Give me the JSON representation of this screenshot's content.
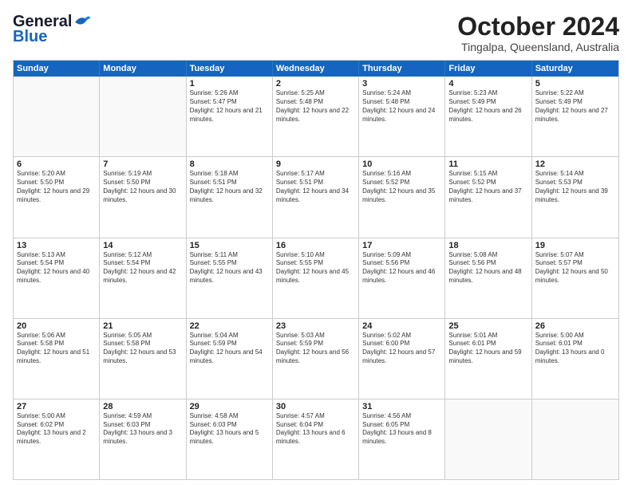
{
  "logo": {
    "line1": "General",
    "line2": "Blue"
  },
  "title": "October 2024",
  "location": "Tingalpa, Queensland, Australia",
  "days_of_week": [
    "Sunday",
    "Monday",
    "Tuesday",
    "Wednesday",
    "Thursday",
    "Friday",
    "Saturday"
  ],
  "weeks": [
    [
      {
        "day": "",
        "sunrise": "",
        "sunset": "",
        "daylight": "",
        "empty": true
      },
      {
        "day": "",
        "sunrise": "",
        "sunset": "",
        "daylight": "",
        "empty": true
      },
      {
        "day": "1",
        "sunrise": "Sunrise: 5:26 AM",
        "sunset": "Sunset: 5:47 PM",
        "daylight": "Daylight: 12 hours and 21 minutes."
      },
      {
        "day": "2",
        "sunrise": "Sunrise: 5:25 AM",
        "sunset": "Sunset: 5:48 PM",
        "daylight": "Daylight: 12 hours and 22 minutes."
      },
      {
        "day": "3",
        "sunrise": "Sunrise: 5:24 AM",
        "sunset": "Sunset: 5:48 PM",
        "daylight": "Daylight: 12 hours and 24 minutes."
      },
      {
        "day": "4",
        "sunrise": "Sunrise: 5:23 AM",
        "sunset": "Sunset: 5:49 PM",
        "daylight": "Daylight: 12 hours and 26 minutes."
      },
      {
        "day": "5",
        "sunrise": "Sunrise: 5:22 AM",
        "sunset": "Sunset: 5:49 PM",
        "daylight": "Daylight: 12 hours and 27 minutes."
      }
    ],
    [
      {
        "day": "6",
        "sunrise": "Sunrise: 5:20 AM",
        "sunset": "Sunset: 5:50 PM",
        "daylight": "Daylight: 12 hours and 29 minutes."
      },
      {
        "day": "7",
        "sunrise": "Sunrise: 5:19 AM",
        "sunset": "Sunset: 5:50 PM",
        "daylight": "Daylight: 12 hours and 30 minutes."
      },
      {
        "day": "8",
        "sunrise": "Sunrise: 5:18 AM",
        "sunset": "Sunset: 5:51 PM",
        "daylight": "Daylight: 12 hours and 32 minutes."
      },
      {
        "day": "9",
        "sunrise": "Sunrise: 5:17 AM",
        "sunset": "Sunset: 5:51 PM",
        "daylight": "Daylight: 12 hours and 34 minutes."
      },
      {
        "day": "10",
        "sunrise": "Sunrise: 5:16 AM",
        "sunset": "Sunset: 5:52 PM",
        "daylight": "Daylight: 12 hours and 35 minutes."
      },
      {
        "day": "11",
        "sunrise": "Sunrise: 5:15 AM",
        "sunset": "Sunset: 5:52 PM",
        "daylight": "Daylight: 12 hours and 37 minutes."
      },
      {
        "day": "12",
        "sunrise": "Sunrise: 5:14 AM",
        "sunset": "Sunset: 5:53 PM",
        "daylight": "Daylight: 12 hours and 39 minutes."
      }
    ],
    [
      {
        "day": "13",
        "sunrise": "Sunrise: 5:13 AM",
        "sunset": "Sunset: 5:54 PM",
        "daylight": "Daylight: 12 hours and 40 minutes."
      },
      {
        "day": "14",
        "sunrise": "Sunrise: 5:12 AM",
        "sunset": "Sunset: 5:54 PM",
        "daylight": "Daylight: 12 hours and 42 minutes."
      },
      {
        "day": "15",
        "sunrise": "Sunrise: 5:11 AM",
        "sunset": "Sunset: 5:55 PM",
        "daylight": "Daylight: 12 hours and 43 minutes."
      },
      {
        "day": "16",
        "sunrise": "Sunrise: 5:10 AM",
        "sunset": "Sunset: 5:55 PM",
        "daylight": "Daylight: 12 hours and 45 minutes."
      },
      {
        "day": "17",
        "sunrise": "Sunrise: 5:09 AM",
        "sunset": "Sunset: 5:56 PM",
        "daylight": "Daylight: 12 hours and 46 minutes."
      },
      {
        "day": "18",
        "sunrise": "Sunrise: 5:08 AM",
        "sunset": "Sunset: 5:56 PM",
        "daylight": "Daylight: 12 hours and 48 minutes."
      },
      {
        "day": "19",
        "sunrise": "Sunrise: 5:07 AM",
        "sunset": "Sunset: 5:57 PM",
        "daylight": "Daylight: 12 hours and 50 minutes."
      }
    ],
    [
      {
        "day": "20",
        "sunrise": "Sunrise: 5:06 AM",
        "sunset": "Sunset: 5:58 PM",
        "daylight": "Daylight: 12 hours and 51 minutes."
      },
      {
        "day": "21",
        "sunrise": "Sunrise: 5:05 AM",
        "sunset": "Sunset: 5:58 PM",
        "daylight": "Daylight: 12 hours and 53 minutes."
      },
      {
        "day": "22",
        "sunrise": "Sunrise: 5:04 AM",
        "sunset": "Sunset: 5:59 PM",
        "daylight": "Daylight: 12 hours and 54 minutes."
      },
      {
        "day": "23",
        "sunrise": "Sunrise: 5:03 AM",
        "sunset": "Sunset: 5:59 PM",
        "daylight": "Daylight: 12 hours and 56 minutes."
      },
      {
        "day": "24",
        "sunrise": "Sunrise: 5:02 AM",
        "sunset": "Sunset: 6:00 PM",
        "daylight": "Daylight: 12 hours and 57 minutes."
      },
      {
        "day": "25",
        "sunrise": "Sunrise: 5:01 AM",
        "sunset": "Sunset: 6:01 PM",
        "daylight": "Daylight: 12 hours and 59 minutes."
      },
      {
        "day": "26",
        "sunrise": "Sunrise: 5:00 AM",
        "sunset": "Sunset: 6:01 PM",
        "daylight": "Daylight: 13 hours and 0 minutes."
      }
    ],
    [
      {
        "day": "27",
        "sunrise": "Sunrise: 5:00 AM",
        "sunset": "Sunset: 6:02 PM",
        "daylight": "Daylight: 13 hours and 2 minutes."
      },
      {
        "day": "28",
        "sunrise": "Sunrise: 4:59 AM",
        "sunset": "Sunset: 6:03 PM",
        "daylight": "Daylight: 13 hours and 3 minutes."
      },
      {
        "day": "29",
        "sunrise": "Sunrise: 4:58 AM",
        "sunset": "Sunset: 6:03 PM",
        "daylight": "Daylight: 13 hours and 5 minutes."
      },
      {
        "day": "30",
        "sunrise": "Sunrise: 4:57 AM",
        "sunset": "Sunset: 6:04 PM",
        "daylight": "Daylight: 13 hours and 6 minutes."
      },
      {
        "day": "31",
        "sunrise": "Sunrise: 4:56 AM",
        "sunset": "Sunset: 6:05 PM",
        "daylight": "Daylight: 13 hours and 8 minutes."
      },
      {
        "day": "",
        "sunrise": "",
        "sunset": "",
        "daylight": "",
        "empty": true
      },
      {
        "day": "",
        "sunrise": "",
        "sunset": "",
        "daylight": "",
        "empty": true
      }
    ]
  ]
}
